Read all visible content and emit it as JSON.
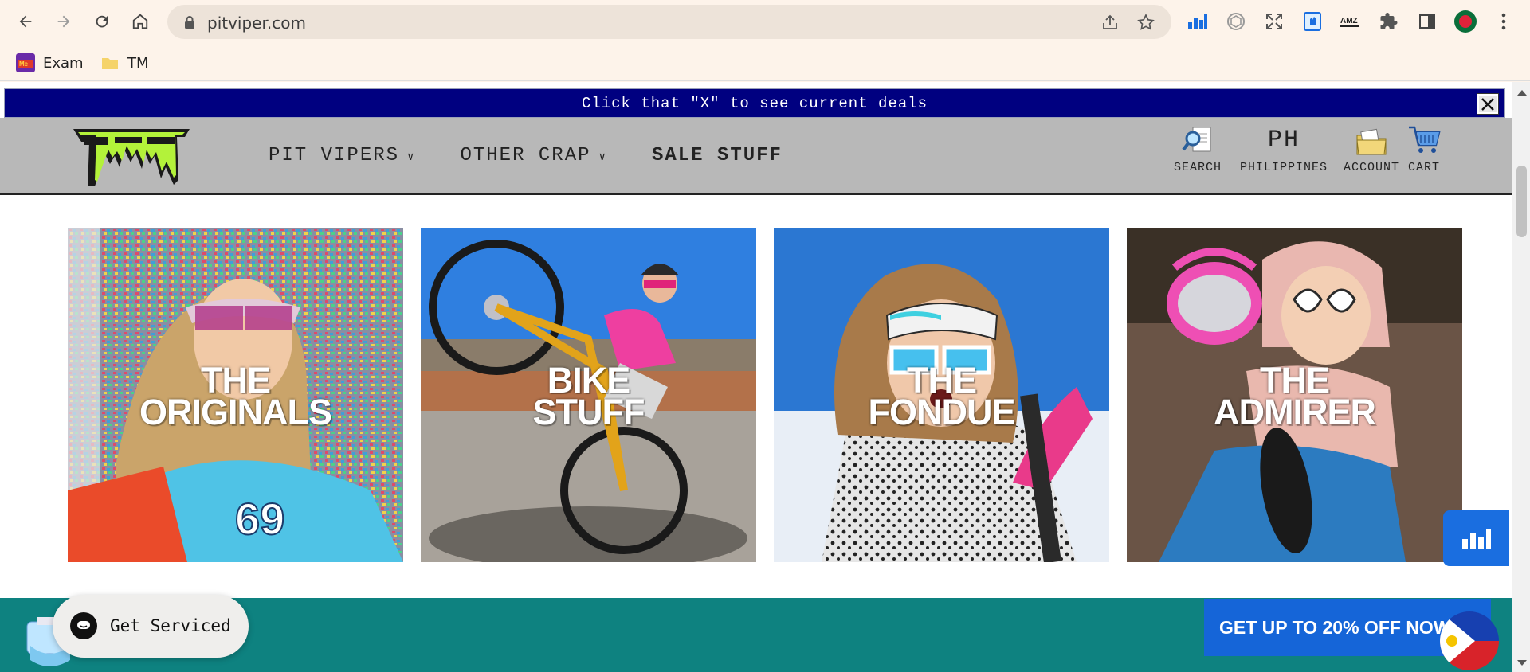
{
  "browser": {
    "url": "pitviper.com",
    "bookmarks": [
      {
        "label": "Exam"
      },
      {
        "label": "TM"
      }
    ]
  },
  "promo": {
    "text": "Click that \"X\" to see current deals"
  },
  "header": {
    "nav": [
      {
        "label": "PIT VIPERS"
      },
      {
        "label": "OTHER CRAP"
      },
      {
        "label": "SALE STUFF"
      }
    ],
    "utility": {
      "search": "SEARCH",
      "region_code": "PH",
      "region_name": "PHILIPPINES",
      "account": "ACCOUNT",
      "cart": "CART"
    }
  },
  "tiles": [
    {
      "line1": "THE",
      "line2": "ORIGINALS"
    },
    {
      "line1": "BIKE",
      "line2": "STUFF"
    },
    {
      "line1": "THE",
      "line2": "FONDUE"
    },
    {
      "line1": "THE",
      "line2": "ADMIRER"
    }
  ],
  "footer_band": {
    "chat_label": "Get Serviced",
    "deal_label": "GET UP TO 20% OFF NOW"
  },
  "colors": {
    "promo_bg": "#000080",
    "header_bg": "#b8b8b8",
    "teal_band": "#0e8280",
    "deal_button": "#1565d8"
  }
}
